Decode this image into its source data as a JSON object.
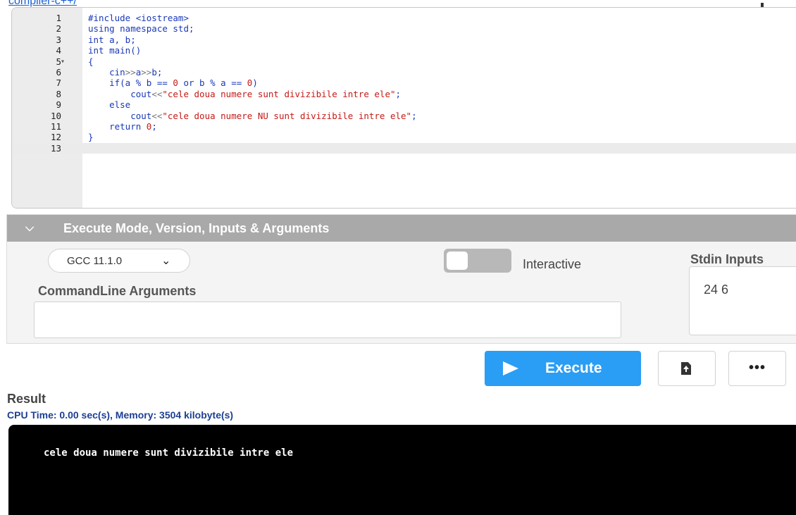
{
  "top_link": "compiler-c++/",
  "editor": {
    "lines": [
      {
        "no": "1",
        "fold": "",
        "segments": [
          {
            "t": "#include <iostream>",
            "c": "k-blue"
          }
        ]
      },
      {
        "no": "2",
        "fold": "",
        "segments": [
          {
            "t": "using namespace std;",
            "c": "k-blue"
          }
        ]
      },
      {
        "no": "3",
        "fold": "",
        "segments": [
          {
            "t": "int a, b;",
            "c": "k-blue"
          }
        ]
      },
      {
        "no": "4",
        "fold": "",
        "segments": [
          {
            "t": "int main()",
            "c": "k-blue"
          }
        ]
      },
      {
        "no": "5",
        "fold": "▾",
        "segments": [
          {
            "t": "{",
            "c": "k-blue"
          }
        ]
      },
      {
        "no": "6",
        "fold": "",
        "segments": [
          {
            "t": "    cin",
            "c": "k-blue"
          },
          {
            "t": ">>",
            "c": "k-grey"
          },
          {
            "t": "a",
            "c": "k-blue"
          },
          {
            "t": ">>",
            "c": "k-grey"
          },
          {
            "t": "b;",
            "c": "k-blue"
          }
        ]
      },
      {
        "no": "7",
        "fold": "",
        "segments": [
          {
            "t": "    if",
            "c": "k-blue"
          },
          {
            "t": "(a % b == ",
            "c": "k-blue"
          },
          {
            "t": "0",
            "c": "k-red"
          },
          {
            "t": " or b % a == ",
            "c": "k-blue"
          },
          {
            "t": "0",
            "c": "k-red"
          },
          {
            "t": ")",
            "c": "k-blue"
          }
        ]
      },
      {
        "no": "8",
        "fold": "",
        "segments": [
          {
            "t": "        cout",
            "c": "k-blue"
          },
          {
            "t": "<<",
            "c": "k-grey"
          },
          {
            "t": "\"cele doua numere sunt divizibile intre ele\"",
            "c": "k-red"
          },
          {
            "t": ";",
            "c": "k-blue"
          }
        ]
      },
      {
        "no": "9",
        "fold": "",
        "segments": [
          {
            "t": "    else",
            "c": "k-blue"
          }
        ]
      },
      {
        "no": "10",
        "fold": "",
        "segments": [
          {
            "t": "        cout",
            "c": "k-blue"
          },
          {
            "t": "<<",
            "c": "k-grey"
          },
          {
            "t": "\"cele doua numere NU sunt divizibile intre ele\"",
            "c": "k-red"
          },
          {
            "t": ";",
            "c": "k-blue"
          }
        ]
      },
      {
        "no": "11",
        "fold": "",
        "segments": [
          {
            "t": "    return ",
            "c": "k-blue"
          },
          {
            "t": "0",
            "c": "k-red"
          },
          {
            "t": ";",
            "c": "k-blue"
          }
        ]
      },
      {
        "no": "12",
        "fold": "",
        "segments": [
          {
            "t": "}",
            "c": "k-blue"
          }
        ]
      },
      {
        "no": "13",
        "fold": "",
        "segments": [
          {
            "t": "",
            "c": "k-blue"
          }
        ]
      }
    ],
    "active_line": "13"
  },
  "exec_panel": {
    "title": "Execute Mode, Version, Inputs & Arguments",
    "chevron_icon": "chevron-down-icon",
    "version": "GCC 11.1.0",
    "interactive_label": "Interactive",
    "cmd_label": "CommandLine Arguments",
    "cmd_value": "",
    "stdin_label": "Stdin Inputs",
    "stdin_value": "24 6"
  },
  "actions": {
    "execute_label": "Execute",
    "upload_icon": "file-upload-icon",
    "more_icon": "more-options-icon",
    "more_label": "•••"
  },
  "result": {
    "label": "Result",
    "cpu_line": "CPU Time: 0.00 sec(s), Memory: 3504 kilobyte(s)",
    "output": "cele doua numere sunt divizibile intre ele"
  }
}
